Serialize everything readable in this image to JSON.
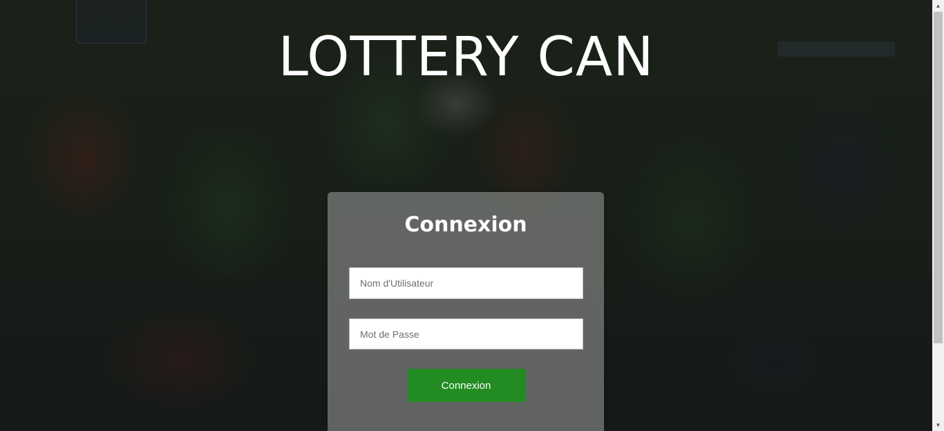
{
  "header": {
    "title": "LOTTERY CAN"
  },
  "login": {
    "heading": "Connexion",
    "username_placeholder": "Nom d'Utilisateur",
    "password_placeholder": "Mot de Passe",
    "submit_label": "Connexion"
  },
  "colors": {
    "submit_button": "#228b22",
    "title_text": "#ffffff",
    "card_overlay": "rgba(160,160,160,0.55)"
  },
  "icons": {
    "scroll_up": "chevron-up-icon",
    "scroll_down": "chevron-down-icon"
  }
}
